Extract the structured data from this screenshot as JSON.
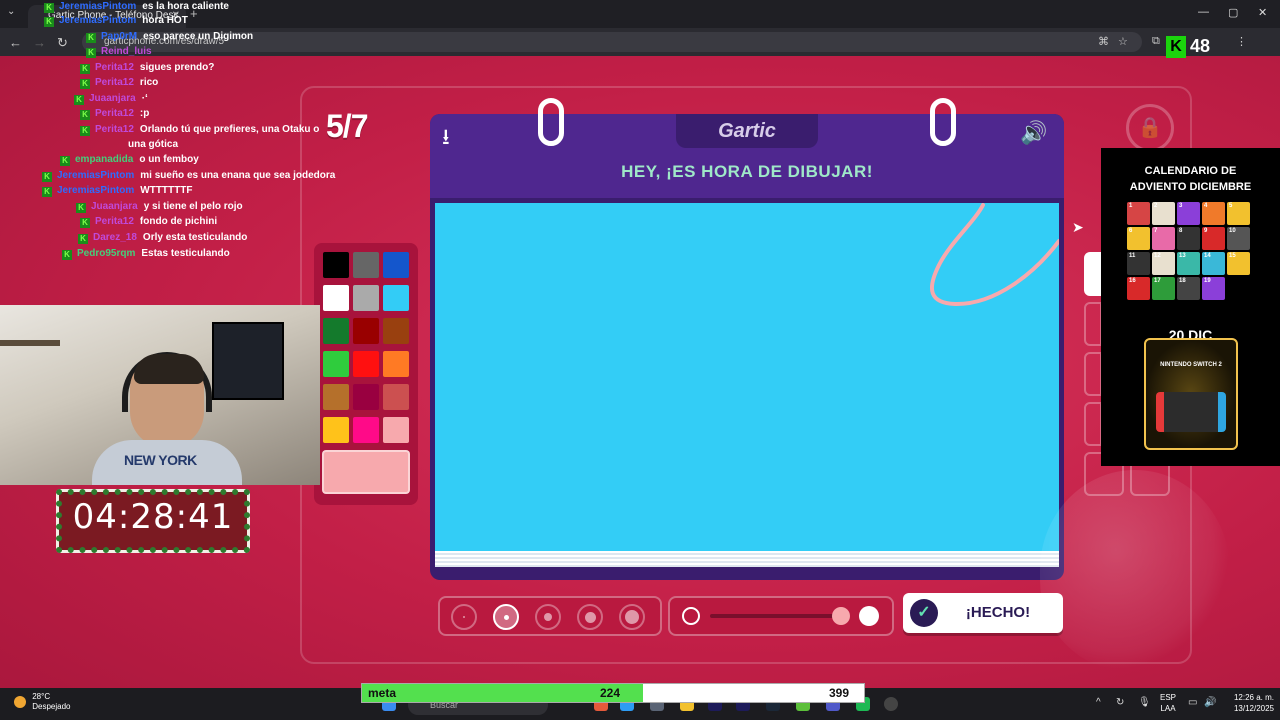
{
  "browser": {
    "tab_title": "Gartic Phone - Teléfono Desc",
    "tab_close": "✕",
    "new_tab": "+",
    "url": "garticphone.com/es/draw/5"
  },
  "chat": [
    {
      "user": "JeremiasPintom",
      "user_color": "#2f6cff",
      "text": "es la hora caliente"
    },
    {
      "user": "JeremiasPintom",
      "user_color": "#2f6cff",
      "text": "hora HOT"
    },
    {
      "user": "Pap0rM",
      "user_color": "#2f6cff",
      "text": "eso parece un Digimon"
    },
    {
      "user": "Reind_luis",
      "user_color": "#c04ad9",
      "text": ""
    },
    {
      "user": "Perita12",
      "user_color": "#c04ad9",
      "text": "sigues prendo?"
    },
    {
      "user": "Perita12",
      "user_color": "#c04ad9",
      "text": "rico"
    },
    {
      "user": "Juaanjara",
      "user_color": "#c04ad9",
      "text": "·ʻ"
    },
    {
      "user": "Perita12",
      "user_color": "#c04ad9",
      "text": ":p"
    },
    {
      "user": "Perita12",
      "user_color": "#c04ad9",
      "text": "Orlando tú que prefieres, una Otaku o"
    },
    {
      "user": "",
      "user_color": "#c04ad9",
      "text": "una gótica"
    },
    {
      "user": "empanadida",
      "user_color": "#43d07b",
      "text": "o un femboy"
    },
    {
      "user": "JeremiasPintom",
      "user_color": "#2f6cff",
      "text": "mi sueño es una enana que sea jodedora"
    },
    {
      "user": "JeremiasPintom",
      "user_color": "#2f6cff",
      "text": "WTTTTTTF"
    },
    {
      "user": "Juaanjara",
      "user_color": "#c04ad9",
      "text": "y si tiene el pelo rojo"
    },
    {
      "user": "Perita12",
      "user_color": "#c04ad9",
      "text": "fondo de pichini"
    },
    {
      "user": "Darez_18",
      "user_color": "#c04ad9",
      "text": "Orly esta testiculando"
    },
    {
      "user": "Pedro95rqm",
      "user_color": "#43d07b",
      "text": "Estas testiculando"
    }
  ],
  "game": {
    "round_counter": "5/7",
    "logo": "Gartic",
    "heading": "HEY, ¡ES HORA DE DIBUJAR!",
    "done_label": "¡HECHO!",
    "download_icon": "⭳",
    "sound_icon": "🔊",
    "lock_icon": "🔒",
    "canvas_color": "#33cdf6",
    "stroke_color": "#f7a9ad",
    "current_color": "#f7a9ad",
    "palette": [
      "#000000",
      "#666666",
      "#1456cc",
      "#ffffff",
      "#aaaaaa",
      "#33ccf6",
      "#147a2c",
      "#990000",
      "#99400f",
      "#2fcc3d",
      "#ff1010",
      "#ff7a24",
      "#b5702b",
      "#990040",
      "#cc5050",
      "#ffc21a",
      "#ff0a88",
      "#f7a9ad"
    ],
    "brush_sizes": 5,
    "selected_brush": 2
  },
  "stream": {
    "timer": "04:28:41",
    "k_count": "48",
    "shirt_text": "NEW YORK"
  },
  "advent": {
    "title_line1": "CALENDARIO DE",
    "title_line2": "ADVIENTO DICIEMBRE",
    "date": "20 DIC",
    "prize": "NINTENDO SWITCH 2",
    "days": [
      "1",
      "2",
      "3",
      "4",
      "5",
      "6",
      "7",
      "8",
      "9",
      "10",
      "11",
      "12",
      "13",
      "14",
      "15",
      "16",
      "17",
      "18",
      "19"
    ]
  },
  "taskbar": {
    "weather_temp": "28°C",
    "weather_desc": "Despejado",
    "search_placeholder": "Buscar",
    "meta_label": "meta",
    "meta_value": "224",
    "meta_goal": "399",
    "meta_progress": 0.56,
    "lang1": "ESP",
    "lang2": "LAA",
    "time": "12:26 a. m.",
    "date": "13/12/2025"
  }
}
